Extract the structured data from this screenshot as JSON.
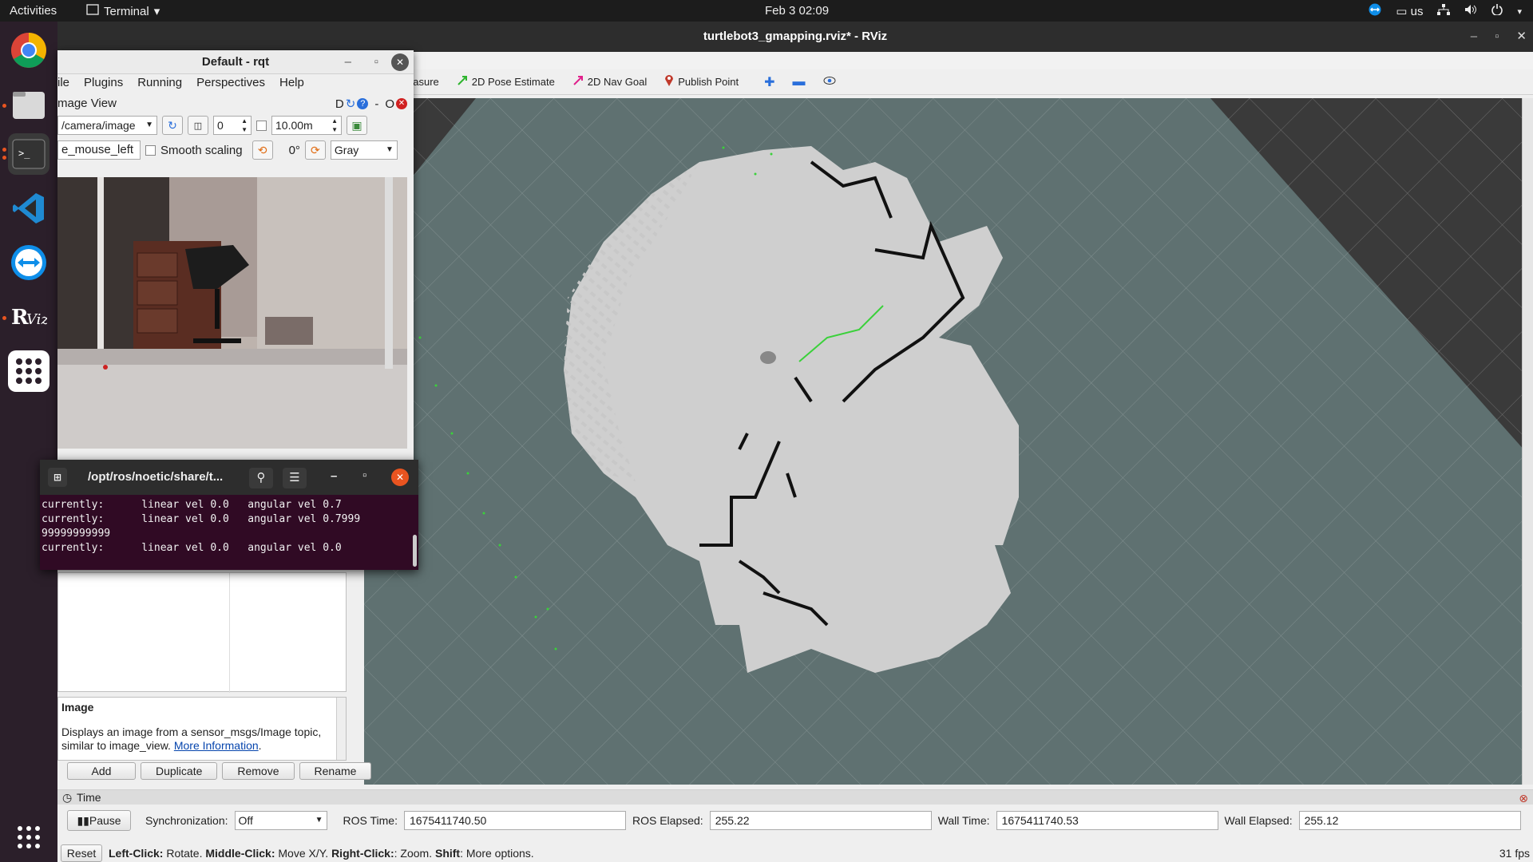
{
  "topbar": {
    "activities": "Activities",
    "app_name": "Terminal",
    "clock": "Feb 3  02:09",
    "keyboard": "us"
  },
  "dock": {
    "items": [
      "chrome-icon",
      "files-icon",
      "terminal-icon",
      "vscode-icon",
      "teamviewer-icon",
      "rviz-icon",
      "app-grid-icon"
    ]
  },
  "rviz": {
    "title": "turtlebot3_gmapping.rviz* - RViz",
    "toolbar": {
      "measure": "easure",
      "pose_estimate": "2D Pose Estimate",
      "nav_goal": "2D Nav Goal",
      "publish_point": "Publish Point"
    },
    "display_desc": {
      "title": "Image",
      "text": "Displays an image from a sensor_msgs/Image topic, similar to image_view.",
      "link": "More Information"
    },
    "buttons": {
      "add": "Add",
      "duplicate": "Duplicate",
      "remove": "Remove",
      "rename": "Rename"
    },
    "time": {
      "header": "Time",
      "pause": "Pause",
      "sync_label": "Synchronization:",
      "sync_value": "Off",
      "ros_time_label": "ROS Time:",
      "ros_time": "1675411740.50",
      "ros_elapsed_label": "ROS Elapsed:",
      "ros_elapsed": "255.22",
      "wall_time_label": "Wall Time:",
      "wall_time": "1675411740.53",
      "wall_elapsed_label": "Wall Elapsed:",
      "wall_elapsed": "255.12"
    },
    "status": {
      "reset": "Reset",
      "left_click": "Left-Click:",
      "left_click_desc": " Rotate. ",
      "middle_click": "Middle-Click:",
      "middle_click_desc": " Move X/Y. ",
      "right_click": "Right-Click:",
      "right_click_desc": ": Zoom. ",
      "shift": "Shift",
      "shift_desc": ": More options.",
      "fps": "31 fps"
    }
  },
  "rqt": {
    "title": "Default - rqt",
    "menu": [
      "ile",
      "Plugins",
      "Running",
      "Perspectives",
      "Help"
    ],
    "plugin_title": "mage View",
    "plugin_controls": "D",
    "plugin_close": "O",
    "topic": "/camera/image",
    "num_value": "0",
    "zoom_value": "10.00m",
    "mouse_topic": "e_mouse_left",
    "smooth_scaling": "Smooth scaling",
    "rotation": "0°",
    "color_scheme": "Gray"
  },
  "terminal": {
    "title": "/opt/ros/noetic/share/t...",
    "lines": [
      "currently:      linear vel 0.0   angular vel 0.7",
      "currently:      linear vel 0.0   angular vel 0.7999",
      "99999999999",
      "currently:      linear vel 0.0   angular vel 0.0"
    ]
  }
}
